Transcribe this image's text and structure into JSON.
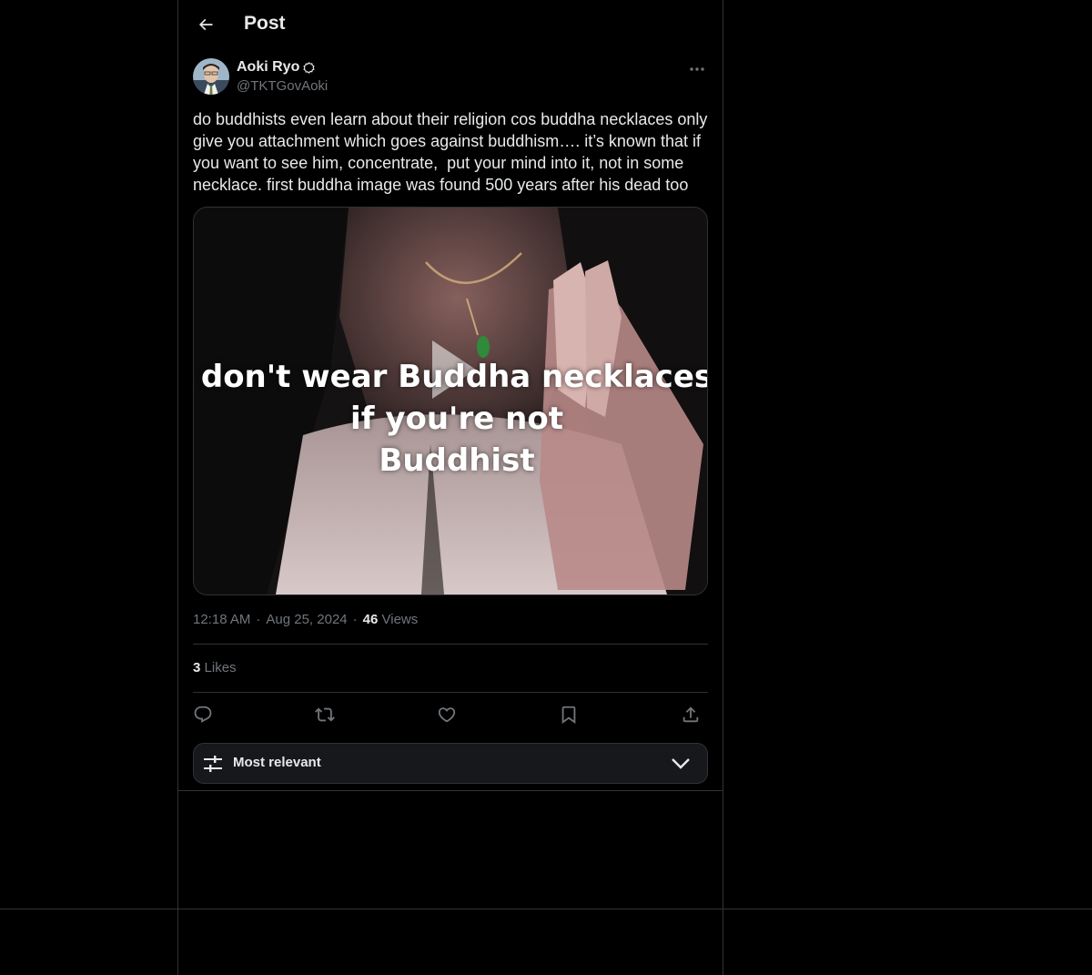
{
  "header": {
    "title": "Post"
  },
  "author": {
    "name": "Aoki Ryo",
    "handle": "@TKTGovAoki"
  },
  "post": {
    "text": "do buddhists even learn about their religion cos buddha necklaces only give you attachment which goes against buddhism…. it’s known that if you want to see him, concentrate,  put your mind into it, not in some necklace. first buddha image was found 500 years after his dead too",
    "media_caption_lines": [
      "don't wear Buddha necklaces",
      "if you're not",
      "Buddhist"
    ]
  },
  "meta": {
    "time": "12:18 AM",
    "dot1": "·",
    "date": "Aug 25, 2024",
    "dot2": "·",
    "views_count": "46",
    "views_label": "Views"
  },
  "stats": {
    "likes_count": "3",
    "likes_label": "Likes"
  },
  "actions": [
    {
      "name": "reply",
      "icon": "reply-icon"
    },
    {
      "name": "repost",
      "icon": "repost-icon"
    },
    {
      "name": "like",
      "icon": "heart-icon"
    },
    {
      "name": "bookmark",
      "icon": "bookmark-icon"
    },
    {
      "name": "share",
      "icon": "share-icon"
    }
  ],
  "sort": {
    "label": "Most relevant"
  },
  "colors": {
    "background": "#000000",
    "border": "#2f3336",
    "text_primary": "#e7e9ea",
    "text_secondary": "#71767b",
    "sort_bar_bg": "#16181c"
  }
}
